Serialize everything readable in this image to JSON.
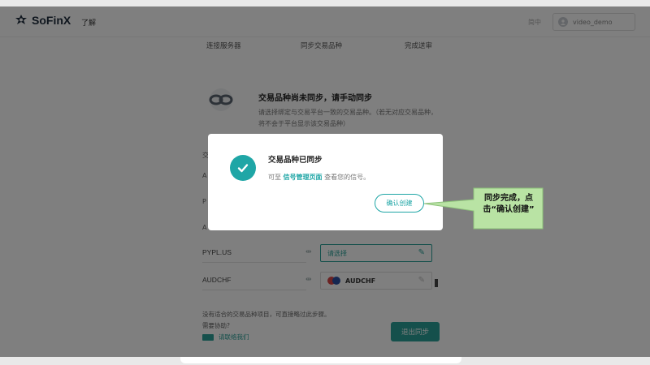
{
  "app": {
    "name": "SoFinX"
  },
  "topbar": {
    "learn": "了解",
    "lang": "简中",
    "user": "video_demo"
  },
  "steps": [
    "连接服务器",
    "同步交易品种",
    "完成送审"
  ],
  "card": {
    "title": "交易品种尚未同步，请手动同步",
    "desc": "请选择绑定与交易平台一致的交易品种。（若无对应交易品种，将不会于平台显示该交易品种）",
    "partial_labels": [
      "交",
      "A",
      "P",
      "A"
    ],
    "rows": [
      {
        "symbol": "PYPL.US",
        "select": "请选择"
      },
      {
        "symbol": "AUDCHF",
        "select": "AUDCHF"
      }
    ],
    "footer_line1": "没有适合的交易品种项目，可直接略过此步骤。",
    "footer_line2": "需要协助?",
    "contact": "请联络我们",
    "exit_button": "退出同步"
  },
  "modal": {
    "title": "交易品种已同步",
    "desc_prefix": "可至",
    "desc_link": "信号管理页面",
    "desc_suffix": "查看您的信号。",
    "confirm_button": "确认创建"
  },
  "callout": {
    "line1": "同步完成，点",
    "line2": "击“确认创建”"
  },
  "colors": {
    "accent": "#1fa6a6",
    "callout_bg": "#b9e3a4"
  }
}
